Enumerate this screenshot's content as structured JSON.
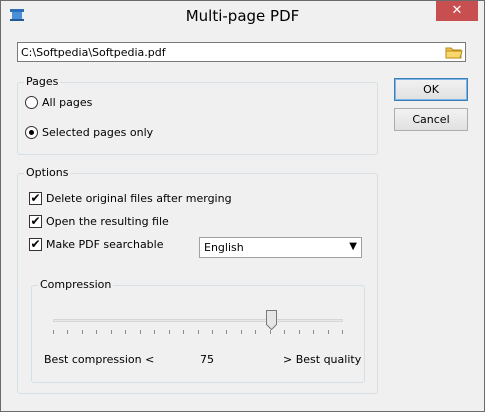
{
  "window": {
    "title": "Multi-page PDF",
    "close_glyph": "✕"
  },
  "path": {
    "value": "C:\\Softpedia\\Softpedia.pdf"
  },
  "pages": {
    "label": "Pages",
    "all_label": "All pages",
    "selected_label": "Selected pages only",
    "selected": "selected"
  },
  "options": {
    "label": "Options",
    "delete_label": "Delete original files after merging",
    "open_label": "Open the resulting file",
    "searchable_label": "Make PDF searchable",
    "delete_checked": true,
    "open_checked": true,
    "searchable_checked": true,
    "language": "English"
  },
  "compression": {
    "label": "Compression",
    "left_label": "Best compression <",
    "value": "75",
    "right_label": "> Best quality",
    "level": 0.75,
    "tick_count": 21
  },
  "buttons": {
    "ok": "OK",
    "cancel": "Cancel"
  },
  "icons": {
    "app": "scanner-icon",
    "folder": "folder-icon",
    "close": "close-icon"
  }
}
